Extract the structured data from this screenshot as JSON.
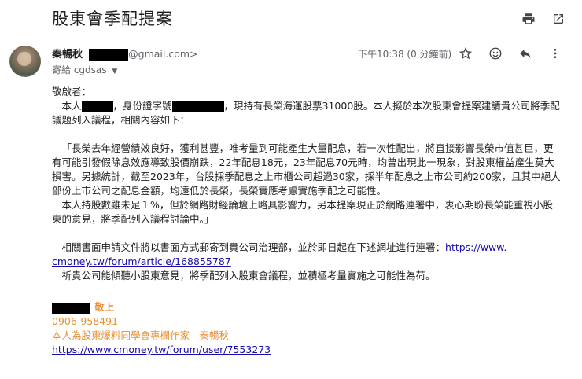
{
  "subject": "股東會季配提案",
  "sender": {
    "name": "秦暢秋",
    "email_suffix": "@gmail.com>",
    "to_label": "寄給 cgdsas"
  },
  "time": "下午10:38 (0 分鐘前)",
  "icons": {
    "print": "print-icon",
    "open_new": "open-in-new-icon",
    "star": "star-icon",
    "emoji": "emoji-icon",
    "reply": "reply-icon",
    "more": "more-vert-icon"
  },
  "body": {
    "greeting": "敬啟者：",
    "p1a": "本人",
    "p1b": "，身份證字號",
    "p1c": "，現持有長榮海運股票31000股。本人擬於本次股東會提案建請貴公司將季配",
    "p1d": "議題列入議程，相關內容如下：",
    "q1": "「長榮去年經營績效良好，獲利甚豐，唯考量到可能產生大量配息，若一次性配出，將直接影響長榮市值甚巨，更",
    "q2": "有可能引發假除息效應導致股價崩跌，22年配息18元，23年配息70元時，均曾出現此一現象，對股東權益產生莫大",
    "q3": "損害。另據統計，截至2023年，台股採季配息之上市櫃公司超過30家，採半年配息之上市公司約200家，且其中絕大",
    "q4": "部份上市公司之配息金額，均遠低於長榮，長榮實應考慮實施季配之可能性。",
    "q5": "本人持股數雖未足１%，但於網路財經論壇上略具影響力，另本提案現正於網路連署中，衷心期盼長榮能重視小股",
    "q6": "東的意見，將季配列入議程討論中。」",
    "p2a": "相關書面申請文件將以書面方式郵寄到貴公司治理部，並於即日起在下述網址進行連署：",
    "link1a": "https://www.",
    "link1b": "cmoney.tw/forum/article/168855787",
    "p3": "祈貴公司能傾聽小股東意見，將季配列入股東會議程，並積極考量實施之可能性為荷。"
  },
  "signature": {
    "closing": "敬上",
    "phone": "0906-958491",
    "line": "本人為股東爆料同學會專欄作家　秦暢秋",
    "link": "https://www.cmoney.tw/forum/user/7553273"
  },
  "colors": {
    "accent": "#e69138",
    "link": "#1a0dab"
  }
}
